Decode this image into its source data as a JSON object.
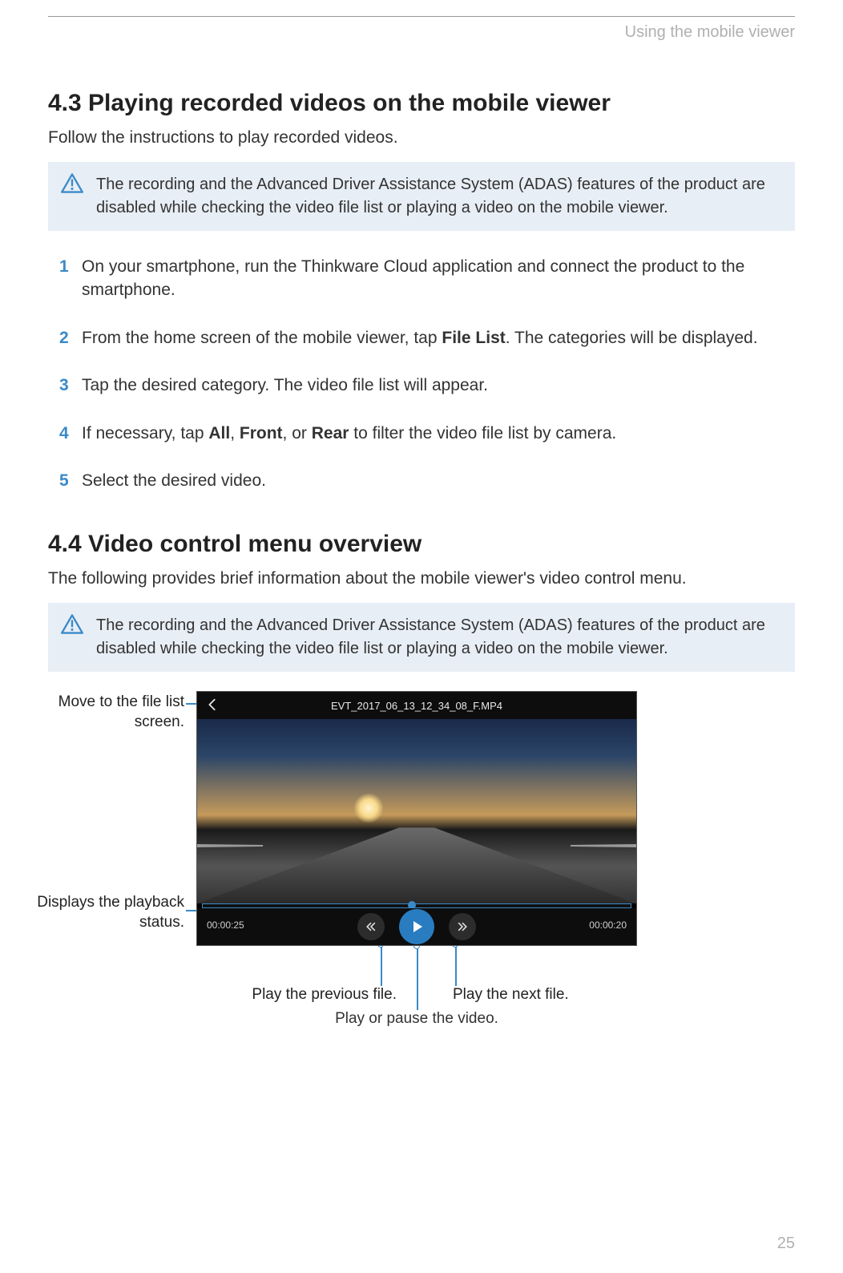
{
  "header": {
    "section": "Using the mobile viewer"
  },
  "s43": {
    "heading": "4.3   Playing recorded videos on the mobile viewer",
    "intro": "Follow the instructions to play recorded videos.",
    "note": "The recording and the Advanced Driver Assistance System (ADAS) features of the product are disabled while checking the video file list or playing a video on the mobile viewer.",
    "steps": [
      {
        "n": "1",
        "html": "On your smartphone, run the Thinkware Cloud application and connect the product to the smartphone."
      },
      {
        "n": "2",
        "html": "From the home screen of the mobile viewer, tap <b>File List</b>. The categories will be displayed."
      },
      {
        "n": "3",
        "html": "Tap the desired category. The video file list will appear."
      },
      {
        "n": "4",
        "html": "If necessary, tap <b>All</b>, <b>Front</b>, or <b>Rear</b> to filter the video file list by camera."
      },
      {
        "n": "5",
        "html": "Select the desired video."
      }
    ]
  },
  "s44": {
    "heading": "4.4   Video control menu overview",
    "intro": "The following provides brief information about the mobile viewer's video control menu.",
    "note": "The recording and the Advanced Driver Assistance System (ADAS) features of the product are disabled while checking the video file list or playing a video on the mobile viewer.",
    "player": {
      "filename": "EVT_2017_06_13_12_34_08_F.MP4",
      "elapsed": "00:00:25",
      "remaining": "00:00:20"
    },
    "callouts": {
      "back": "Move to the file list screen.",
      "progress": "Displays the playback status.",
      "prev": "Play the previous file.",
      "play": "Play or pause the video.",
      "next": "Play the next file."
    }
  },
  "page": "25"
}
